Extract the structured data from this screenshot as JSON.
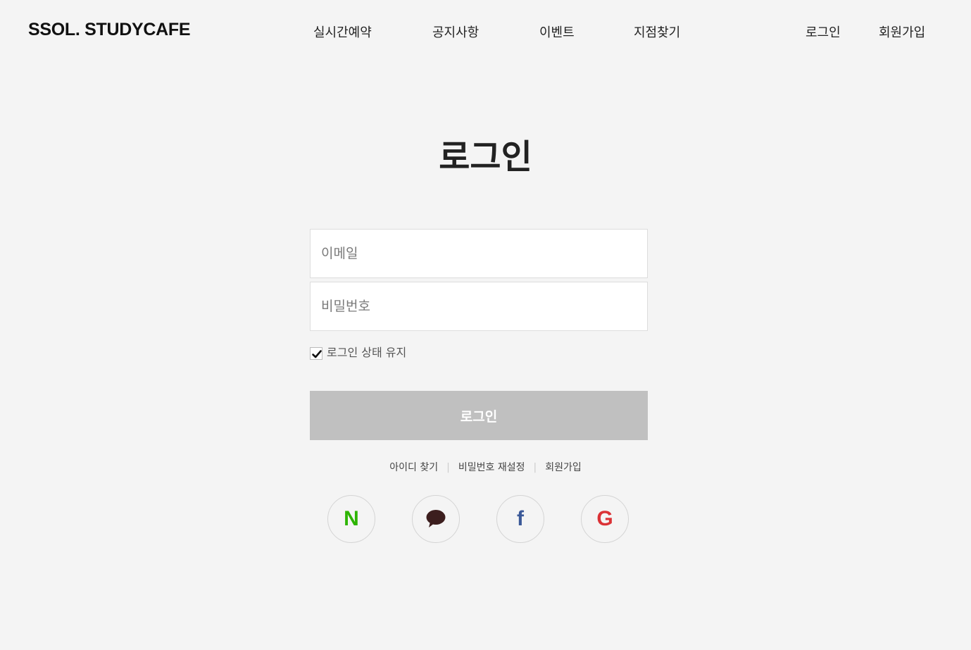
{
  "header": {
    "logo": "SSOL. STUDYCAFE",
    "nav": [
      {
        "label": "실시간예약"
      },
      {
        "label": "공지사항"
      },
      {
        "label": "이벤트"
      },
      {
        "label": "지점찾기"
      }
    ],
    "account": [
      {
        "label": "로그인"
      },
      {
        "label": "회원가입"
      }
    ]
  },
  "main": {
    "title": "로그인",
    "email": {
      "placeholder": "이메일",
      "value": ""
    },
    "password": {
      "placeholder": "비밀번호",
      "value": ""
    },
    "keep_login": {
      "label": "로그인 상태 유지",
      "checked": true
    },
    "login_button": "로그인",
    "links": [
      {
        "label": "아이디 찾기"
      },
      {
        "label": "비밀번호 재설정"
      },
      {
        "label": "회원가입"
      }
    ],
    "social": [
      {
        "icon": "naver-icon",
        "glyph": "N",
        "color": "#2db400"
      },
      {
        "icon": "kakao-icon",
        "glyph": "speech-bubble",
        "color": "#3c1e1e"
      },
      {
        "icon": "facebook-icon",
        "glyph": "f",
        "color": "#3b5998"
      },
      {
        "icon": "google-icon",
        "glyph": "G",
        "color": "#db3236"
      }
    ]
  },
  "colors": {
    "background": "#f4f4f4",
    "button_disabled": "#c0c0c0",
    "text": "#222222"
  }
}
